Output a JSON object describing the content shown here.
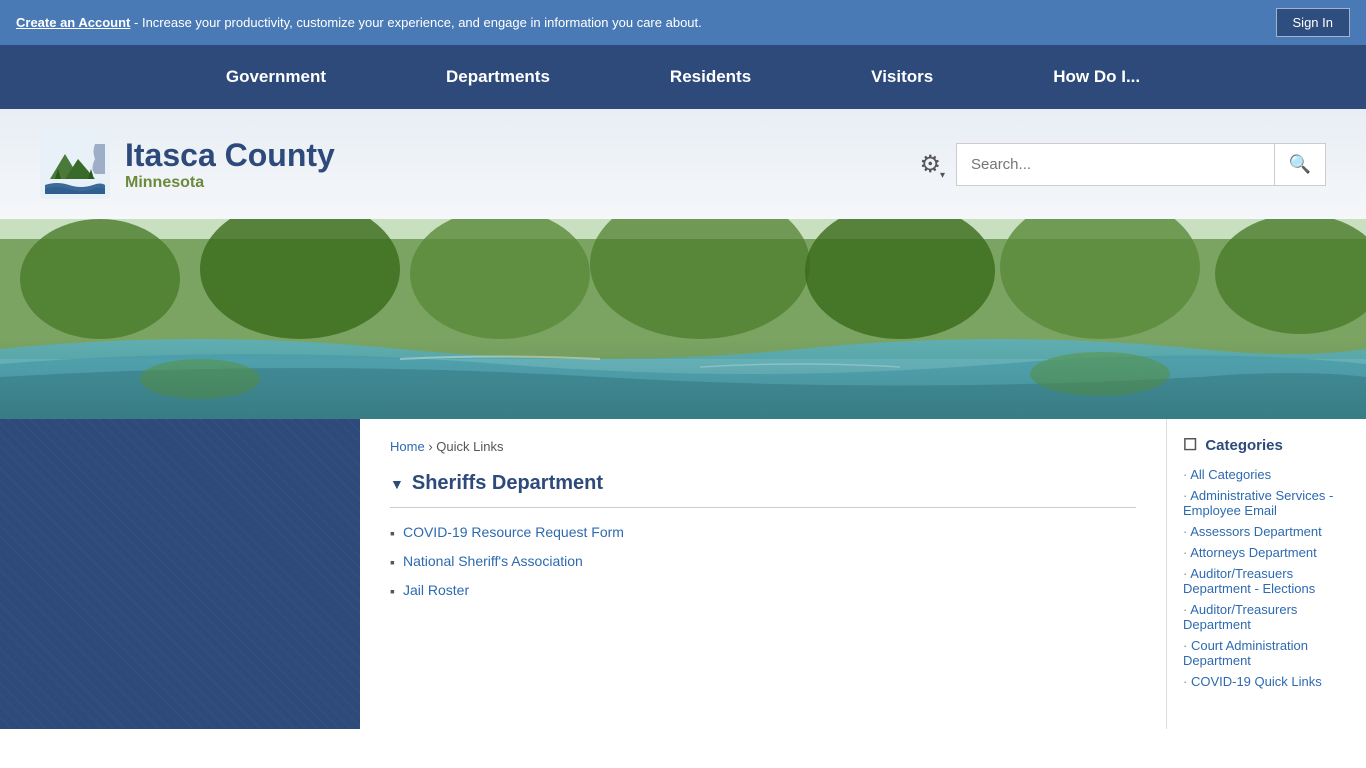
{
  "topBar": {
    "createAccount": "Create an Account",
    "message": " - Increase your productivity, customize your experience, and engage in information you care about.",
    "signIn": "Sign In"
  },
  "nav": {
    "items": [
      {
        "label": "Government",
        "href": "#"
      },
      {
        "label": "Departments",
        "href": "#"
      },
      {
        "label": "Residents",
        "href": "#"
      },
      {
        "label": "Visitors",
        "href": "#"
      },
      {
        "label": "How Do I...",
        "href": "#"
      }
    ]
  },
  "header": {
    "siteTitle": "Itasca County",
    "siteSubtitle": "Minnesota",
    "searchPlaceholder": "Search..."
  },
  "breadcrumb": {
    "home": "Home",
    "current": "Quick Links"
  },
  "section": {
    "title": "Sheriffs Department",
    "links": [
      {
        "label": "COVID-19 Resource Request Form",
        "href": "#"
      },
      {
        "label": "National Sheriff's Association",
        "href": "#"
      },
      {
        "label": "Jail Roster",
        "href": "#"
      }
    ]
  },
  "categories": {
    "heading": "Categories",
    "items": [
      {
        "label": "All Categories",
        "href": "#"
      },
      {
        "label": "Administrative Services - Employee Email",
        "href": "#"
      },
      {
        "label": "Assessors Department",
        "href": "#"
      },
      {
        "label": "Attorneys Department",
        "href": "#"
      },
      {
        "label": "Auditor/Treasuers Department - Elections",
        "href": "#"
      },
      {
        "label": "Auditor/Treasurers Department",
        "href": "#"
      },
      {
        "label": "Court Administration Department",
        "href": "#"
      },
      {
        "label": "COVID-19 Quick Links",
        "href": "#"
      }
    ]
  }
}
